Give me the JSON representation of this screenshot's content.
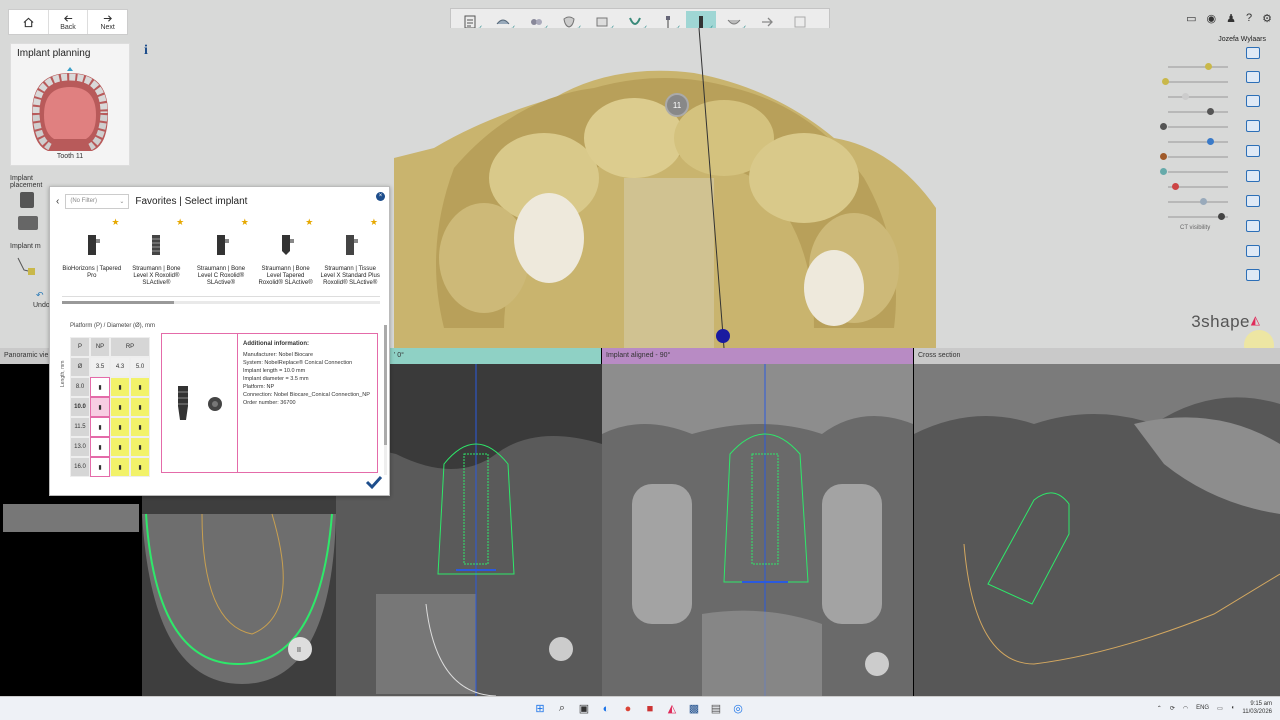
{
  "nav": {
    "back_label": "Back",
    "next_label": "Next"
  },
  "toolbar": {
    "tools": [
      "checklist-icon",
      "scan-icon",
      "segment-icon",
      "tooth-icon",
      "box-icon",
      "jaw-icon",
      "implant-tool-icon",
      "implant-active-icon",
      "guide-icon",
      "order-icon",
      "export-icon"
    ]
  },
  "user": {
    "name": "Jozefa Wylaars"
  },
  "left_panel": {
    "title": "Implant planning",
    "tooth_label": "Tooth 11",
    "section_placement": "Implant placement",
    "section_m": "Implant m",
    "undo_label": "Undo"
  },
  "brand": "3shape",
  "ct_visibility_label": "CT visibility",
  "views": {
    "panoramic": "Panoramic vie",
    "implant0": "' 0°",
    "implant90": "Implant aligned - 90°",
    "cross": "Cross section"
  },
  "tooth_marker": "11",
  "dialog": {
    "filter": "(No Filter)",
    "title": "Favorites | Select implant",
    "favorites": [
      {
        "name": "BioHorizons | Tapered Pro"
      },
      {
        "name": "Straumann | Bone Level X Roxolid® SLActive®"
      },
      {
        "name": "Straumann | Bone Level C Roxolid® SLActive®"
      },
      {
        "name": "Straumann | Bone Level Tapered Roxolid® SLActive®"
      },
      {
        "name": "Straumann | Tissue Level X Standard Plus Roxolid® SLActive®"
      }
    ],
    "grid_title": "Platform (P) / Diameter (Ø), mm",
    "length_label": "Length, mm",
    "grid": {
      "platform_header": "P",
      "platforms": [
        "NP",
        "RP"
      ],
      "diameter_header": "Ø",
      "diameters": [
        "3.5",
        "4.3",
        "5.0"
      ],
      "lengths": [
        "8.0",
        "10.0",
        "11.5",
        "13.0",
        "16.0"
      ]
    },
    "info": {
      "heading": "Additional information:",
      "lines": [
        "Manufacturer: Nobel Biocare",
        "System: NobelReplace® Conical Connection",
        "Implant length = 10.0 mm",
        "Implant diameter = 3.5 mm",
        "Platform: NP",
        "Connection: Nobel Biocare_Conical Connection_NP",
        "Order number: 36700"
      ]
    }
  },
  "taskbar": {
    "lang": "ENG",
    "time": "9:15 am",
    "date": "11/03/2026"
  },
  "colors": {
    "teal": "#8fd1c5",
    "purple": "#b88bc4",
    "pink": "#e46ba9",
    "yellow": "#f2f26a",
    "implant_green": "#2ee86a",
    "accent_blue": "#1e4e8c"
  }
}
